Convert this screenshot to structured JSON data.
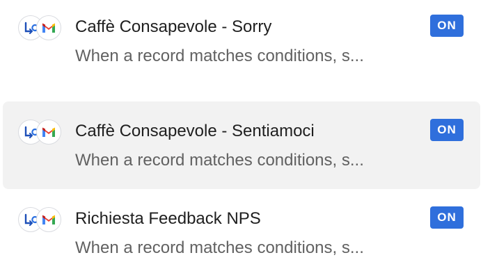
{
  "colors": {
    "badge_bg": "#2f6fdc",
    "selected_row_bg": "#f2f2f2",
    "title_text": "#1f1f1f",
    "desc_text": "#616161"
  },
  "automations": [
    {
      "title": "Caffè Consapevole - Sorry",
      "description": "When a record matches conditions, s...",
      "status": "ON",
      "selected": false,
      "icons": [
        "trigger-record-icon",
        "gmail-icon"
      ]
    },
    {
      "title": "Caffè Consapevole - Sentiamoci",
      "description": "When a record matches conditions, s...",
      "status": "ON",
      "selected": true,
      "icons": [
        "trigger-record-icon",
        "gmail-icon"
      ]
    },
    {
      "title": "Richiesta Feedback NPS",
      "description": "When a record matches conditions, s...",
      "status": "ON",
      "selected": false,
      "icons": [
        "trigger-record-icon",
        "gmail-icon"
      ]
    }
  ]
}
